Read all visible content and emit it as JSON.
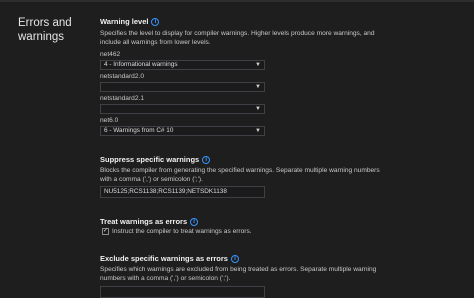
{
  "category": {
    "title": "Errors and warnings"
  },
  "warning_level": {
    "heading": "Warning level",
    "info_icon": "info-icon",
    "description": "Specifies the level to display for compiler warnings. Higher levels produce more warnings, and include all warnings from lower levels.",
    "frameworks": [
      {
        "name": "net462",
        "value": "4 - Informational warnings"
      },
      {
        "name": "netstandard2.0",
        "value": ""
      },
      {
        "name": "netstandard2.1",
        "value": ""
      },
      {
        "name": "net6.0",
        "value": "6 - Warnings from C# 10"
      }
    ]
  },
  "suppress": {
    "heading": "Suppress specific warnings",
    "description": "Blocks the compiler from generating the specified warnings. Separate multiple warning numbers with a comma (',') or semicolon (';').",
    "value": "NU5125;RCS1138;RCS1139;NETSDK1138"
  },
  "treat_as_errors": {
    "heading": "Treat warnings as errors",
    "checked": true,
    "label": "Instruct the compiler to treat warnings as errors."
  },
  "exclude": {
    "heading": "Exclude specific warnings as errors",
    "description": "Specifies which warnings are excluded from being treated as errors. Separate multiple warning numbers with a comma (',') or semicolon (';').",
    "value": ""
  },
  "colors": {
    "background": "#1e1e1e",
    "accent": "#3794ff"
  }
}
